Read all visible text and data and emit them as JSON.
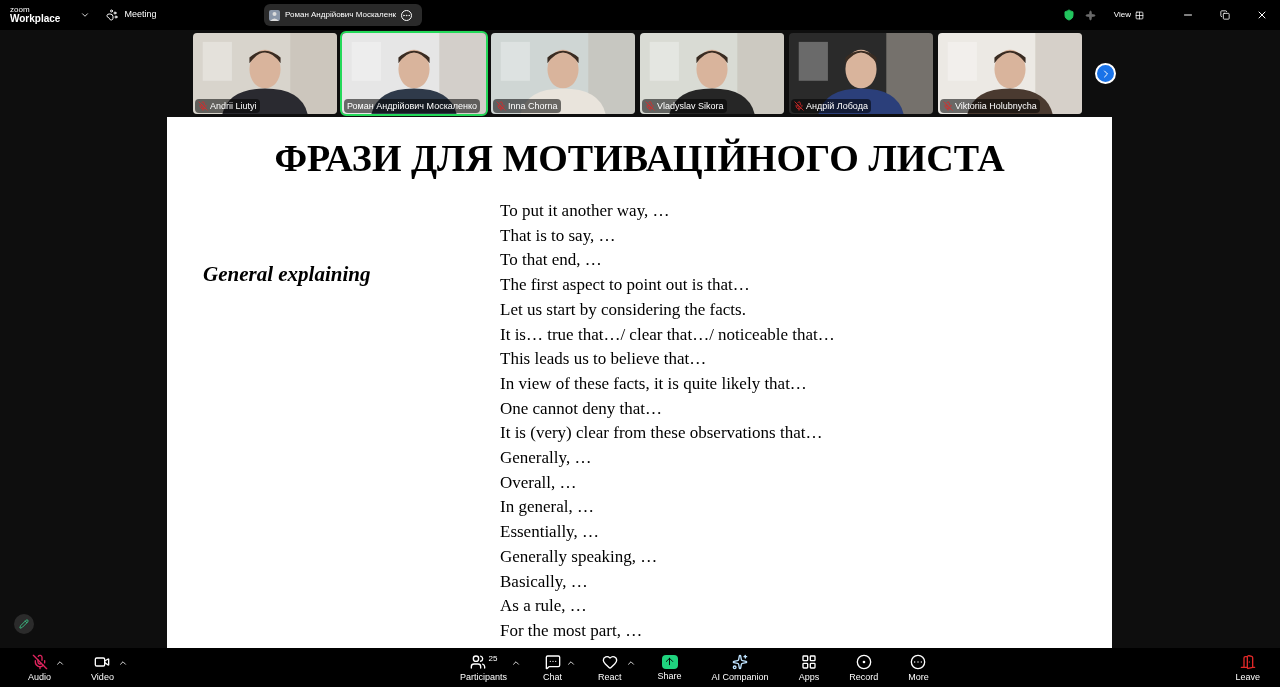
{
  "app_logo": {
    "line_1": "zoom",
    "line_2": "Workplace"
  },
  "meeting_label": "Meeting",
  "active_speaker": "Роман Андрійович Москаленк",
  "view_label": "View",
  "participants": [
    {
      "name": "Andrii Liutyi",
      "muted": true,
      "speaking": false
    },
    {
      "name": "Роман Андрійович Москаленко",
      "muted": false,
      "speaking": true
    },
    {
      "name": "Inna Chorna",
      "muted": true,
      "speaking": false
    },
    {
      "name": "Vladyslav Sikora",
      "muted": true,
      "speaking": false
    },
    {
      "name": "Андрій Лобода",
      "muted": true,
      "speaking": false
    },
    {
      "name": "Viktoriia Holubnycha",
      "muted": true,
      "speaking": false
    }
  ],
  "slide": {
    "title": "ФРАЗИ ДЛЯ МОТИВАЦІЙНОГО ЛИСТА",
    "category": "General explaining",
    "phrases": [
      "To put it another way, …",
      "That is to say, …",
      "To that end, …",
      "The first aspect to point out is that…",
      "Let us start by considering the facts.",
      "It is… true that…/ clear that…/ noticeable that…",
      "This leads us to believe that…",
      "In view of these facts, it is quite likely that…",
      "One cannot deny that…",
      "It is (very) clear from these observations that…",
      "Generally, …",
      "Overall, …",
      "In general, …",
      "Essentially, …",
      "Generally speaking, …",
      "Basically, …",
      "As a rule, …",
      "For the most part, …"
    ]
  },
  "toolbar_left": [
    {
      "label": "Audio",
      "muted": true,
      "has_menu": true
    },
    {
      "label": "Video",
      "has_menu": true
    }
  ],
  "toolbar_center": [
    {
      "label": "Participants",
      "count": "25",
      "has_menu": true
    },
    {
      "label": "Chat",
      "has_menu": true
    },
    {
      "label": "React",
      "has_menu": true
    },
    {
      "label": "Share",
      "has_menu": false
    },
    {
      "label": "AI Companion",
      "has_menu": false
    },
    {
      "label": "Apps",
      "has_menu": false
    },
    {
      "label": "Record",
      "has_menu": false
    },
    {
      "label": "More",
      "has_menu": false
    }
  ],
  "leave_label": "Leave"
}
